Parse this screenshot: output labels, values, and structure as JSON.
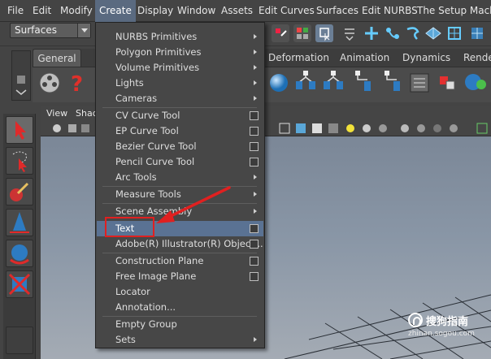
{
  "menubar": {
    "items": [
      "File",
      "Edit",
      "Modify",
      "Create",
      "Display",
      "Window",
      "Assets",
      "Edit Curves",
      "Surfaces",
      "Edit NURBS",
      "The Setup Machine"
    ]
  },
  "status_line": {
    "mode_value": "Surfaces"
  },
  "shelf": {
    "tabs": [
      "General",
      "Deformation",
      "Animation",
      "Dynamics",
      "Render"
    ]
  },
  "panel": {
    "menu": [
      "View",
      "Shad"
    ]
  },
  "create_menu": {
    "items": [
      {
        "label": "NURBS Primitives",
        "submenu": true
      },
      {
        "label": "Polygon Primitives",
        "submenu": true
      },
      {
        "label": "Volume Primitives",
        "submenu": true
      },
      {
        "label": "Lights",
        "submenu": true
      },
      {
        "label": "Cameras",
        "submenu": true
      },
      {
        "label": "CV Curve Tool",
        "option_box": true
      },
      {
        "label": "EP Curve Tool",
        "option_box": true
      },
      {
        "label": "Bezier Curve Tool",
        "option_box": true
      },
      {
        "label": "Pencil Curve Tool",
        "option_box": true
      },
      {
        "label": "Arc Tools",
        "submenu": true
      },
      {
        "label": "Measure Tools",
        "submenu": true
      },
      {
        "label": "Scene Assembly",
        "submenu": true
      },
      {
        "label": "Text",
        "option_box": true,
        "highlighted": true
      },
      {
        "label": "Adobe(R) Illustrator(R) Object...",
        "option_box": true
      },
      {
        "label": "Construction Plane",
        "option_box": true
      },
      {
        "label": "Free Image Plane",
        "option_box": true
      },
      {
        "label": "Locator"
      },
      {
        "label": "Annotation..."
      },
      {
        "label": "Empty Group"
      },
      {
        "label": "Sets",
        "submenu": true
      }
    ]
  },
  "watermark": {
    "name": "搜狗指南",
    "url": "zhinan.sogou.com"
  },
  "colors": {
    "menu_highlight": "#5a7293",
    "annotation_red": "#e02020",
    "viewport_top": "#7b8797",
    "viewport_bottom": "#a4abb4"
  }
}
